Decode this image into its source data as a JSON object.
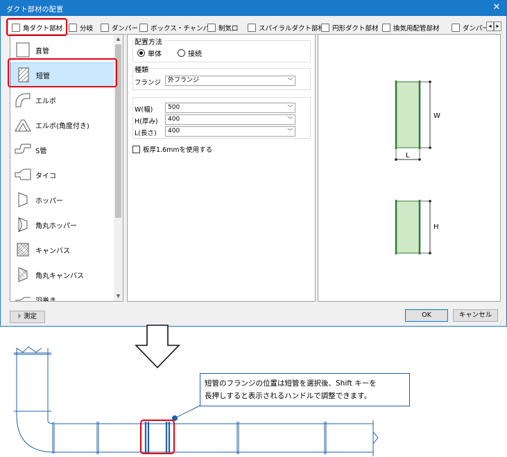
{
  "dialog": {
    "title": "ダクト部材の配置",
    "close_glyph": "✕",
    "tabs": [
      {
        "label": "角ダクト部材",
        "active": true
      },
      {
        "label": "分岐"
      },
      {
        "label": "ダンパー"
      },
      {
        "label": "ボックス・チャンバー"
      },
      {
        "label": "制気口"
      },
      {
        "label": "スパイラルダクト部材"
      },
      {
        "label": "円形ダクト部材"
      },
      {
        "label": "換気用配管部材"
      },
      {
        "label": "ダンパー"
      }
    ],
    "tab_scroll_left": "◂",
    "tab_scroll_right": "▸",
    "part_list": [
      {
        "label": "直管",
        "icon": "straight-pipe-icon"
      },
      {
        "label": "短管",
        "icon": "short-pipe-icon",
        "selected": true
      },
      {
        "label": "エルボ",
        "icon": "elbow-icon"
      },
      {
        "label": "エルボ(角度付き)",
        "icon": "angled-elbow-icon"
      },
      {
        "label": "S管",
        "icon": "s-pipe-icon"
      },
      {
        "label": "タイコ",
        "icon": "taiko-icon"
      },
      {
        "label": "ホッパー",
        "icon": "hopper-icon"
      },
      {
        "label": "角丸ホッパー",
        "icon": "round-hopper-icon"
      },
      {
        "label": "キャンバス",
        "icon": "canvas-icon"
      },
      {
        "label": "角丸キャンバス",
        "icon": "round-canvas-icon"
      },
      {
        "label": "羽巻き",
        "icon": "vane-icon"
      }
    ],
    "placement": {
      "group_label": "配置方法",
      "options": [
        {
          "label": "単体",
          "checked": true
        },
        {
          "label": "接続",
          "checked": false
        }
      ]
    },
    "type": {
      "group_label": "種類",
      "flange_label": "フランジ",
      "flange_value": "外フランジ"
    },
    "dims": [
      {
        "label": "W(幅)",
        "value": "500"
      },
      {
        "label": "H(厚み)",
        "value": "400"
      },
      {
        "label": "L(長さ)",
        "value": "400"
      }
    ],
    "thickness_checkbox": {
      "label": "板厚1.6mmを使用する",
      "checked": false
    },
    "preview": {
      "w_label": "W",
      "l_label": "L",
      "h_label": "H"
    },
    "measure_button": "測定",
    "ok_button": "OK",
    "cancel_button": "キャンセル"
  },
  "callout": {
    "line1": "短管のフランジの位置は短管を選択後、Shift キーを",
    "line2": "長押しすると表示されるハンドルで調整できます。"
  },
  "colors": {
    "title_bar": "#1979ca",
    "highlight": "#e60012",
    "duct_line": "#1f5fa8",
    "preview_fill": "#cfe8c5",
    "preview_stroke": "#2e7d32",
    "selected_row": "#cce8ff"
  }
}
